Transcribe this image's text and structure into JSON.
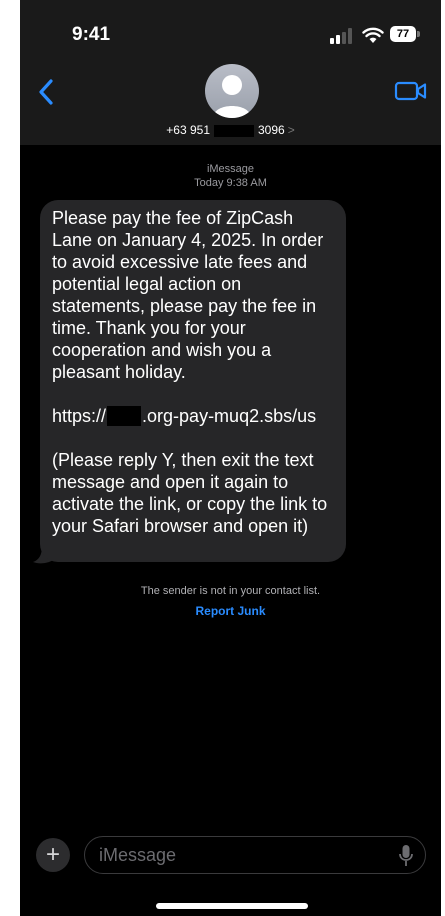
{
  "status": {
    "time": "9:41",
    "battery": "77"
  },
  "header": {
    "number_prefix": "+63 951",
    "number_suffix": "3096",
    "chevron": ">",
    "video_icon": "video-camera-icon"
  },
  "thread": {
    "service": "iMessage",
    "timestamp": "Today 9:38 AM",
    "message_para1": "Please pay the fee of ZipCash Lane on January 4, 2025. In order to avoid excessive late fees and potential legal action on statements, please pay the fee in time. Thank you for your cooperation and wish you a pleasant holiday.",
    "link_prefix": "https://",
    "link_suffix": ".org-pay-muq2.sbs/us",
    "message_para3": "(Please reply Y, then exit the text message and open it again to activate the link, or copy the link to your Safari browser and open it)",
    "notice": "The sender is not in your contact list.",
    "report_label": "Report Junk"
  },
  "composer": {
    "placeholder": "iMessage",
    "plus": "+"
  },
  "colors": {
    "bubble": "#262628",
    "link_blue": "#2a8cff",
    "background": "#000000"
  }
}
